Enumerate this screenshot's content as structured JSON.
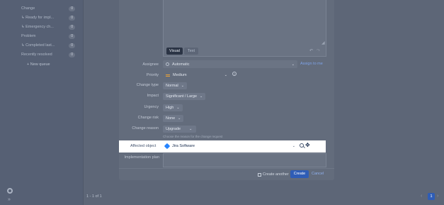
{
  "sidebar": {
    "queues": [
      {
        "label": "Change",
        "count": "0"
      },
      {
        "label": "↳ Ready for impl...",
        "count": "0"
      },
      {
        "label": "↳ Emergency ch...",
        "count": "0"
      },
      {
        "label": "Problem",
        "count": "0"
      },
      {
        "label": "↳ Completed last...",
        "count": "0"
      },
      {
        "label": "Recently resolved",
        "count": "0"
      }
    ],
    "new_queue": "+ New queue",
    "settings_icon": "gear-icon",
    "collapse_icon": "double-chevron-right-icon"
  },
  "list": {
    "pagination_text": "1 - 1 of 1",
    "current_page": "1"
  },
  "editor": {
    "visual_label": "Visual",
    "text_label": "Text"
  },
  "form": {
    "assignee": {
      "label": "Assignee",
      "value": "Automatic",
      "action": "Assign to me"
    },
    "priority": {
      "label": "Priority",
      "value": "Medium"
    },
    "change_type": {
      "label": "Change type",
      "value": "Normal"
    },
    "impact": {
      "label": "Impact",
      "value": "Significant / Large"
    },
    "urgency": {
      "label": "Urgency",
      "value": "High"
    },
    "change_risk": {
      "label": "Change risk",
      "value": "None"
    },
    "change_reason": {
      "label": "Change reason",
      "value": "Upgrade",
      "hint": "Choose the reason for the change request"
    },
    "affected_object": {
      "label": "Affected object",
      "value": "Jira Software"
    },
    "implementation_plan": {
      "label": "Implementation plan"
    }
  },
  "footer": {
    "create_another": "Create another",
    "create": "Create",
    "cancel": "Cancel"
  },
  "colors": {
    "accent": "#2f5db6",
    "priority_medium": "#e5a03a",
    "jira_blue": "#2684ff"
  }
}
